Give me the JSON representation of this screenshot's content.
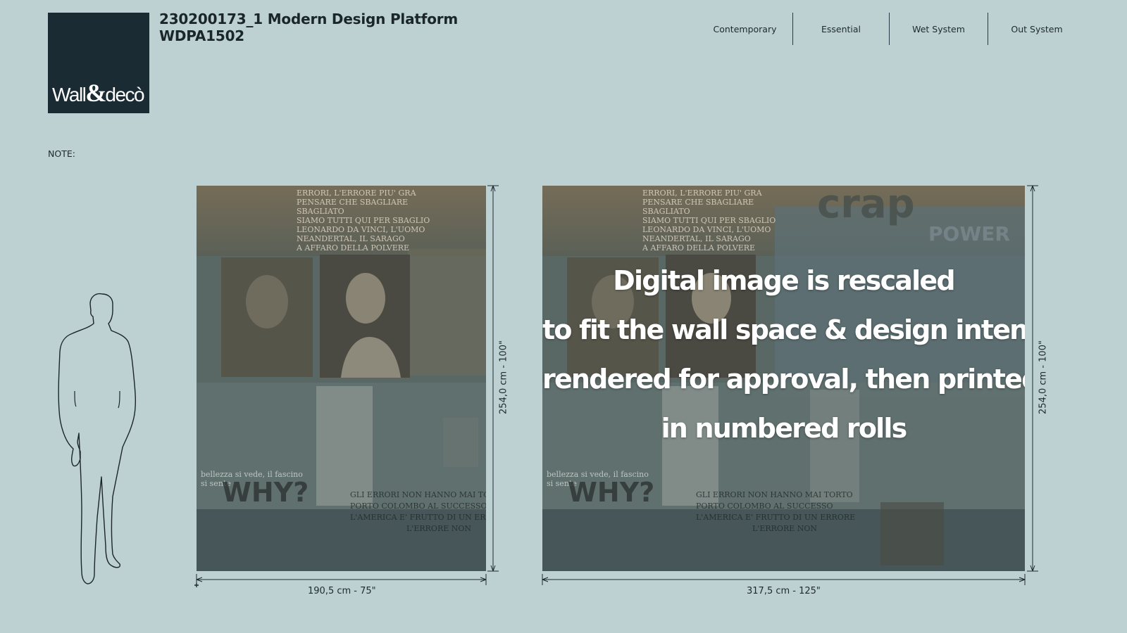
{
  "brand": {
    "logo_text_a": "Wall",
    "logo_text_amp": "&",
    "logo_text_b": "decò",
    "bg_color": "#1a2b33"
  },
  "header": {
    "title_line1": "230200173_1 Modern Design Platform",
    "title_line2": "WDPA1502"
  },
  "nav": {
    "items": [
      "Contemporary",
      "Essential",
      "Wet System",
      "Out System"
    ]
  },
  "note": {
    "label": "NOTE:"
  },
  "panels": {
    "small": {
      "width_label": "190,5 cm - 75\"",
      "height_label": "254,0 cm - 100\""
    },
    "large": {
      "width_label": "317,5 cm - 125\"",
      "height_label": "254,0 cm - 100\"",
      "caption_lines": [
        "Digital image is rescaled",
        "to fit the wall space & design intent,",
        "rendered for approval, then printed",
        "in numbered rolls"
      ]
    }
  },
  "wallpaper_text": {
    "block1": [
      "ERRORI, L'ERRORE PIU' GRA",
      "PENSARE CHE SBAGLIARE",
      "SBAGLIATO",
      "SIAMO TUTTI QUI PER SBAGLIO",
      "LEONARDO DA VINCI, L'UOMO",
      "NEANDERTAL, IL SARAGO",
      "A AFFARO DELLA POLVERE"
    ],
    "block2": [
      "GLI ERRORI NON HANNO MAI TORTO",
      "PORTO COLOMBO AL SUCCESSO",
      "L'AMERICA E' FRUTTO DI UN ERRORE",
      "L'ERRORE NON"
    ],
    "block3": [
      "bellezza si vede, il fascino",
      "si sente"
    ],
    "why": "WHY?",
    "crap": "crap",
    "power": "POWER"
  },
  "colors": {
    "page_bg": "#bdd0d2",
    "ink": "#1d2a30"
  }
}
